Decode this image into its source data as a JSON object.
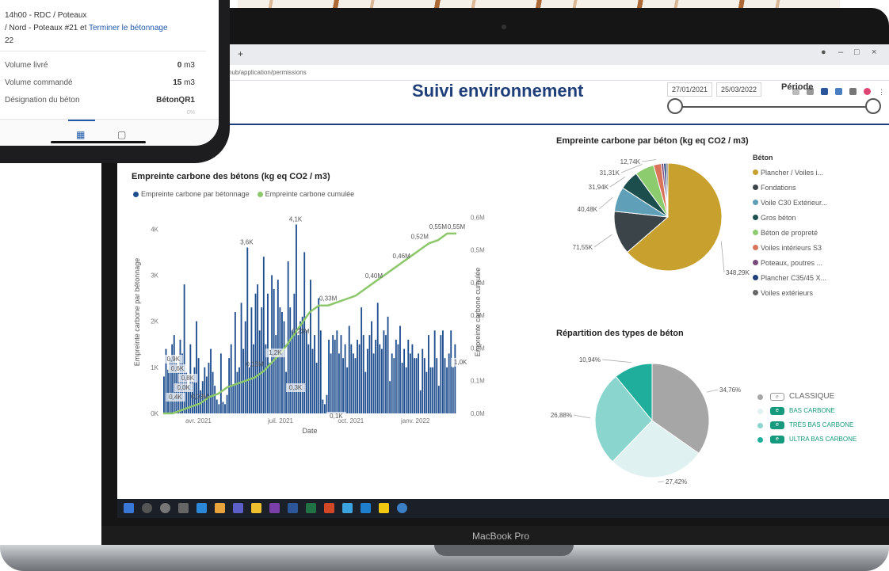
{
  "phone": {
    "task_line1": "14h00 - RDC / Poteaux",
    "task_line2": "/ Nord - Poteaux #21 et ",
    "task_link": "Terminer le bétonnage",
    "task_line3": "22",
    "rows": [
      {
        "label": "Volume livré",
        "value": "0",
        "unit": "m3"
      },
      {
        "label": "Volume commandé",
        "value": "15",
        "unit": "m3"
      },
      {
        "label": "Désignation du béton",
        "value": "BétonQR1",
        "unit": ""
      }
    ],
    "partial_value": "0%"
  },
  "browser": {
    "url": "nub/application/permissions",
    "new_tab": "+",
    "controls": [
      "–",
      "□",
      "×"
    ]
  },
  "dashboard": {
    "title": "Suivi environnement",
    "date_start": "27/01/2021",
    "date_end": "25/03/2022",
    "period_label": "Période"
  },
  "bar_chart": {
    "title": "Empreinte carbone des bétons (kg eq CO2 / m3)",
    "legend_bar": "Empreinte carbone par bétonnage",
    "legend_line": "Empreinte carbone cumulée"
  },
  "pie_beton": {
    "title": "Empreinte carbone par béton (kg eq CO2 / m3)",
    "legend_title": "Béton"
  },
  "pie_types": {
    "title": "Répartition des types de béton"
  },
  "footer": {
    "macbook_label": "MacBook Pro"
  },
  "colors": {
    "bar_blue": "#1f4e8f",
    "line_green": "#8cc86b",
    "title_navy": "#1f3f7a",
    "accent_teal": "#159a7e"
  },
  "chart_data": [
    {
      "type": "bar",
      "title": "Empreinte carbone des bétons (kg eq CO2 / m3)",
      "xlabel": "Date",
      "ylabel": "Empreinte carbone par bétonnage",
      "y2label": "Empreinte carbone cumulée",
      "x_ticks": [
        "avr. 2021",
        "juil. 2021",
        "oct. 2021",
        "janv. 2022"
      ],
      "y_ticks": [
        "0K",
        "1K",
        "2K",
        "3K",
        "4K"
      ],
      "y2_ticks": [
        "0,0M",
        "0,1M",
        "0,2M",
        "0,3M",
        "0,4M",
        "0,5M",
        "0,6M"
      ],
      "ylim": [
        0,
        4400
      ],
      "y2lim": [
        0,
        0.62
      ],
      "series": [
        {
          "name": "Empreinte carbone par bétonnage",
          "bar_heights": [
            800,
            1400,
            950,
            1200,
            1500,
            1700,
            1100,
            900,
            1600,
            1300,
            2800,
            900,
            600,
            1500,
            700,
            1000,
            2000,
            1200,
            500,
            700,
            1000,
            800,
            1100,
            1400,
            900,
            600,
            300,
            200,
            1300,
            250,
            200,
            400,
            1200,
            1500,
            600,
            2200,
            900,
            1000,
            2400,
            1400,
            2000,
            3600,
            1000,
            2300,
            1500,
            2600,
            2800,
            1800,
            2300,
            3400,
            1500,
            2600,
            1100,
            3000,
            2700,
            1700,
            2900,
            2300,
            2200,
            2000,
            900,
            3300,
            2300,
            1800,
            2600,
            4100,
            1700,
            2000,
            2100,
            3500,
            1800,
            1500,
            2900,
            1400,
            1700,
            1100,
            2500,
            1800,
            300,
            200,
            400,
            1600,
            1300,
            1700,
            1600,
            1800,
            1300,
            1700,
            1200,
            1500,
            1000,
            1900,
            1500,
            1300,
            1200,
            1600,
            1500,
            2300,
            1700,
            900,
            1400,
            1700,
            2000,
            1300,
            1600,
            2400,
            1500,
            1400,
            1800,
            1700,
            2100,
            700,
            1300,
            1200,
            1600,
            1500,
            1900,
            1100,
            1400,
            1000,
            1600,
            1300,
            1500,
            1200,
            1200,
            1300,
            500,
            1400,
            1200,
            900,
            1700,
            1000,
            1000,
            1800,
            1200,
            600,
            1700,
            1800,
            1200,
            1000,
            1300,
            1800,
            1000,
            1500
          ],
          "labels": [
            {
              "text": "4,1K",
              "value": 4100
            },
            {
              "text": "3,6K",
              "value": 3600
            },
            {
              "text": "0,9K",
              "value": 900
            },
            {
              "text": "0,6K",
              "value": 600
            },
            {
              "text": "0,8K",
              "value": 800
            },
            {
              "text": "0,0K",
              "value": 0
            },
            {
              "text": "0,4K",
              "value": 400
            },
            {
              "text": "1,2K",
              "value": 1200
            },
            {
              "text": "0,1K",
              "value": 100
            },
            {
              "text": "0,3K",
              "value": 300
            },
            {
              "text": "1,0K",
              "value": 1000
            }
          ]
        },
        {
          "name": "Empreinte carbone cumulée",
          "points_y": [
            0.0,
            0.0,
            0.01,
            0.02,
            0.03,
            0.05,
            0.06,
            0.08,
            0.09,
            0.1,
            0.11,
            0.13,
            0.16,
            0.19,
            0.23,
            0.27,
            0.31,
            0.33,
            0.33,
            0.34,
            0.35,
            0.36,
            0.38,
            0.4,
            0.42,
            0.44,
            0.46,
            0.48,
            0.5,
            0.52,
            0.53,
            0.55,
            0.55
          ],
          "labels": [
            {
              "text": "0,03M",
              "value": 0.03
            },
            {
              "text": "0,13M",
              "value": 0.13
            },
            {
              "text": "0,23M",
              "value": 0.23
            },
            {
              "text": "0,33M",
              "value": 0.33
            },
            {
              "text": "0,40M",
              "value": 0.4
            },
            {
              "text": "0,46M",
              "value": 0.46
            },
            {
              "text": "0,52M",
              "value": 0.52
            },
            {
              "text": "0,55M",
              "value": 0.55
            },
            {
              "text": "0,55M",
              "value": 0.55
            }
          ]
        }
      ]
    },
    {
      "type": "pie",
      "title": "Empreinte carbone par béton (kg eq CO2 / m3)",
      "legend_title": "Béton",
      "slices": [
        {
          "label": "Plancher / Voiles i...",
          "value": 348.29,
          "text": "348,29K",
          "color": "#c7a02e"
        },
        {
          "label": "Fondations",
          "value": 71.55,
          "text": "71,55K",
          "color": "#3b4448"
        },
        {
          "label": "Voile C30 Extérieur...",
          "value": 40.48,
          "text": "40,48K",
          "color": "#5fa0b8"
        },
        {
          "label": "Gros béton",
          "value": 31.94,
          "text": "31,94K",
          "color": "#1d4e4e"
        },
        {
          "label": "Béton de propreté",
          "value": 31.31,
          "text": "31,31K",
          "color": "#8ccc6e"
        },
        {
          "label": "Voiles intérieurs S3",
          "value": 12.74,
          "text": "12,74K",
          "color": "#d9745a"
        },
        {
          "label": "Poteaux, poutres ...",
          "value": 4.0,
          "text": "",
          "color": "#7a4a7a"
        },
        {
          "label": "Plancher C35/45 X...",
          "value": 4.0,
          "text": "",
          "color": "#1f3f7a"
        },
        {
          "label": "Voiles extérieurs",
          "value": 3.0,
          "text": "",
          "color": "#666666"
        }
      ]
    },
    {
      "type": "pie",
      "title": "Répartition des types de béton",
      "slices": [
        {
          "label": "CLASSIQUE",
          "value": 34.76,
          "text": "34,76%",
          "color": "#a6a6a6"
        },
        {
          "label": "BAS CARBONE",
          "value": 27.42,
          "text": "27,42%",
          "color": "#dff1f0"
        },
        {
          "label": "TRÈS BAS CARBONE",
          "value": 26.88,
          "text": "26,88%",
          "color": "#8ad6cf"
        },
        {
          "label": "ULTRA BAS CARBONE",
          "value": 10.94,
          "text": "10,94%",
          "color": "#1fae9c"
        }
      ]
    }
  ]
}
